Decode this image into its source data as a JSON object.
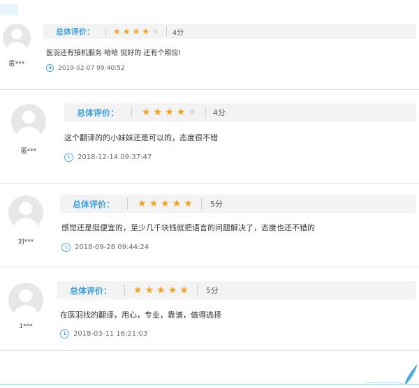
{
  "reviews": [
    {
      "username": "匿***",
      "rating_label": "总体评价：",
      "stars": 4,
      "score": "4分",
      "content": "医羽还有接机服务 哈哈 挺好的 还有个照应!",
      "timestamp": "2019-02-07 09:40:52"
    },
    {
      "username": "匿***",
      "rating_label": "总体评价：",
      "stars": 4,
      "score": "4分",
      "content": "这个翻译的的小妹妹还是可以的，态度很不错",
      "timestamp": "2018-12-14 09:37:47"
    },
    {
      "username": "刘***",
      "rating_label": "总体评价：",
      "stars": 5,
      "score": "5分",
      "content": "感觉还是挺便宜的，至少几千块钱就把语言的问题解决了，态度也还不错的",
      "timestamp": "2018-09-28 09:44:24"
    },
    {
      "username": "1***",
      "rating_label": "总体评价：",
      "stars": 5,
      "score": "5分",
      "content": "在医羽找的翻译，用心，专业，靠谱，值得选择",
      "timestamp": "2018-03-11 16:21:03"
    }
  ],
  "colors": {
    "accent": "#3aa0e0",
    "star": "#f5a21b",
    "star_off": "#d8d8d8"
  }
}
